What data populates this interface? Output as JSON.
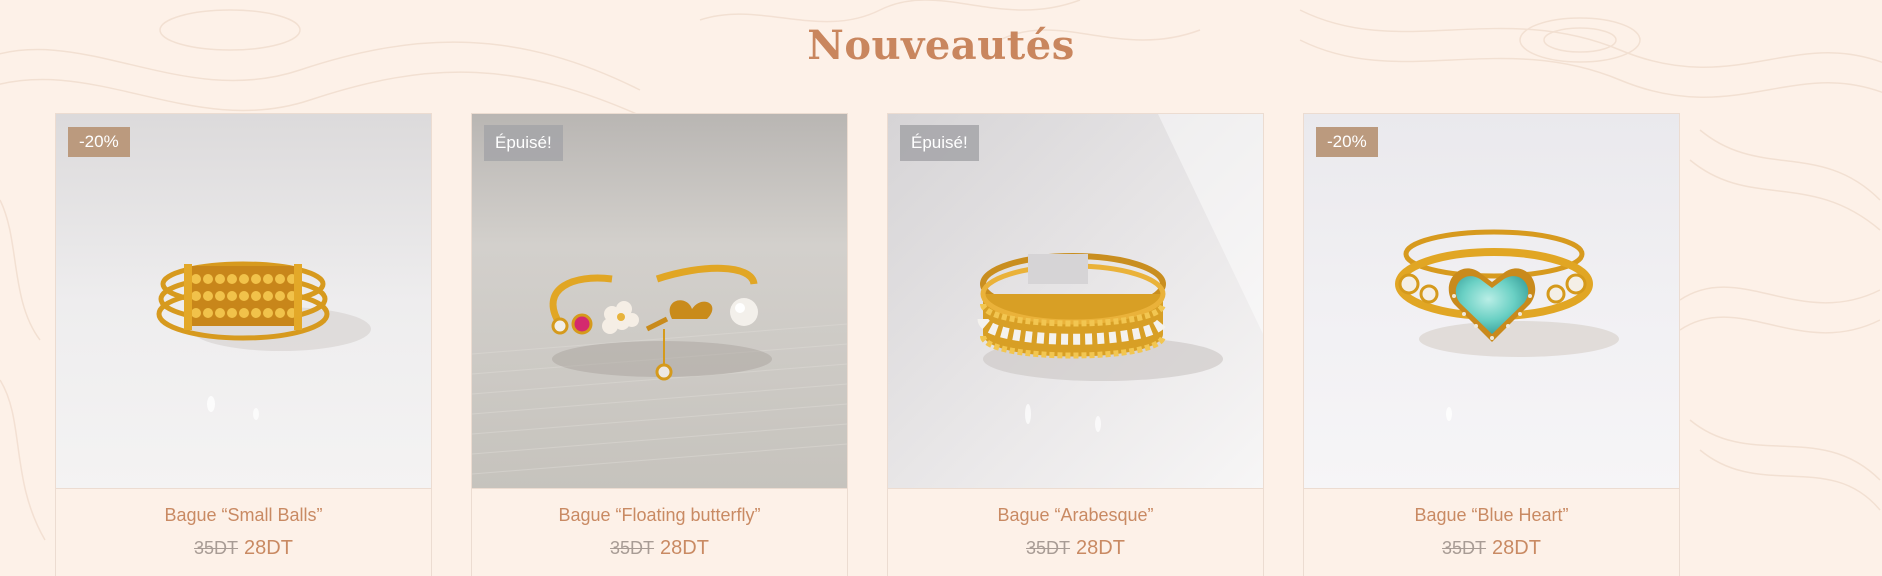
{
  "section": {
    "title": "Nouveautés"
  },
  "colors": {
    "background": "#fdf1e8",
    "accent": "#c9865e",
    "sale_badge": "#bb9a7e",
    "soldout_badge": "#a5a5a8"
  },
  "products": [
    {
      "badge": "-20%",
      "badge_type": "sale",
      "image": "gold-ring-small-balls-icon",
      "title": "Bague “Small Balls”",
      "old_price": "35DT",
      "price": "28DT"
    },
    {
      "badge": "Épuisé!",
      "badge_type": "soldout",
      "image": "gold-ring-floating-butterfly-icon",
      "title": "Bague “Floating butterfly”",
      "old_price": "35DT",
      "price": "28DT"
    },
    {
      "badge": "Épuisé!",
      "badge_type": "soldout",
      "image": "gold-ring-arabesque-icon",
      "title": "Bague “Arabesque”",
      "old_price": "35DT",
      "price": "28DT"
    },
    {
      "badge": "-20%",
      "badge_type": "sale",
      "image": "gold-ring-blue-heart-icon",
      "title": "Bague “Blue Heart”",
      "old_price": "35DT",
      "price": "28DT"
    }
  ]
}
